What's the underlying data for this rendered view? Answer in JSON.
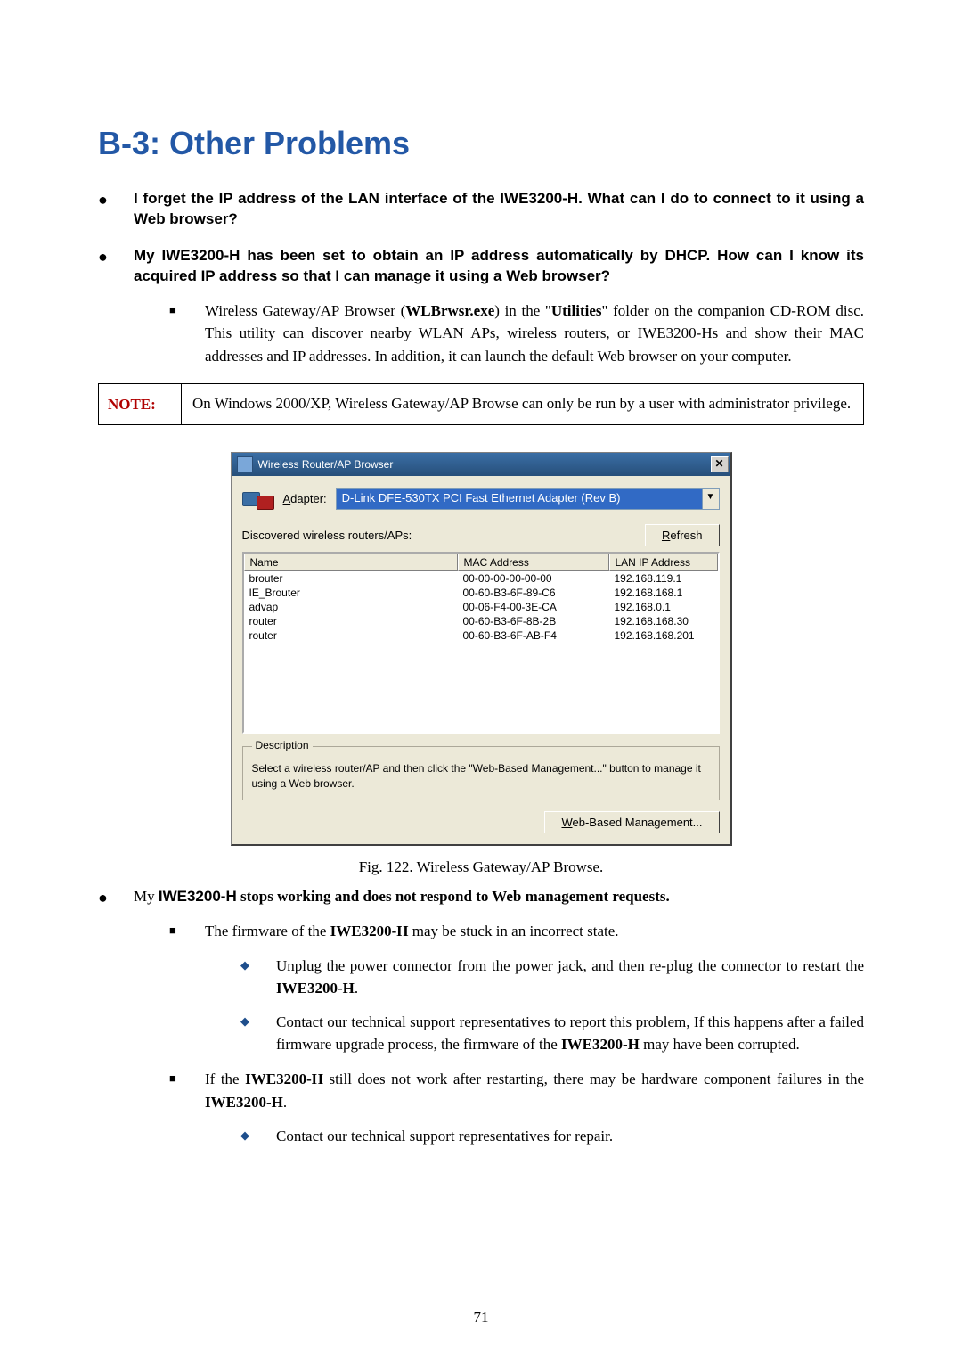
{
  "heading": "B-3: Other Problems",
  "bullets": {
    "b1": {
      "q": "I forget the IP address of the LAN interface of the IWE3200-H. What can I do to connect to it using a Web browser?"
    },
    "b2": {
      "q": "My IWE3200-H has been set to obtain an IP address automatically by DHCP. How can I know its acquired IP address so that I can manage it using a Web browser?",
      "sq_pre": "Wireless Gateway/AP Browser (",
      "sq_bold1": "WLBrwsr.exe",
      "sq_mid": ") in the \"",
      "sq_bold2": "Utilities",
      "sq_post": "\" folder on the companion CD-ROM disc. This utility can discover nearby WLAN APs, wireless routers, or IWE3200-Hs and show their MAC addresses and IP addresses. In addition, it can launch the default Web browser on your computer."
    },
    "b3": {
      "pre": "My ",
      "bold": "IWE3200-H",
      "post": " stops working and does not respond to Web management requests.",
      "sq1_pre": "The firmware of the ",
      "sq1_bold": "IWE3200-H",
      "sq1_post": " may be stuck in an incorrect state.",
      "d1_pre": "Unplug the power connector from the power jack, and then re-plug the connector to restart the ",
      "d1_bold": "IWE3200-H",
      "d1_post": ".",
      "d2_pre": "Contact our technical support representatives to report this problem, If this happens after a failed firmware upgrade process, the firmware of the ",
      "d2_bold": "IWE3200-H",
      "d2_post": " may have been corrupted.",
      "sq2_pre": "If the ",
      "sq2_bold": "IWE3200-H",
      "sq2_mid": " still does not work after restarting, there may be hardware component failures in the ",
      "sq2_bold2": "IWE3200-H",
      "sq2_post": ".",
      "d3": "Contact our technical support representatives for repair."
    }
  },
  "note": {
    "label": "NOTE:",
    "text": "On Windows 2000/XP, Wireless Gateway/AP Browse can only be run by a user with administrator privilege."
  },
  "window": {
    "title": "Wireless Router/AP Browser",
    "adapter_label_a": "A",
    "adapter_label_rest": "dapter:",
    "adapter_value": "D-Link DFE-530TX PCI Fast Ethernet Adapter (Rev B)",
    "discovered": "Discovered wireless routers/APs:",
    "refresh_u": "R",
    "refresh_rest": "efresh",
    "cols": {
      "c0": "Name",
      "c1": "MAC Address",
      "c2": "LAN IP Address"
    },
    "rows": [
      {
        "c0": "brouter",
        "c1": "00-00-00-00-00-00",
        "c2": "192.168.119.1"
      },
      {
        "c0": "IE_Brouter",
        "c1": "00-60-B3-6F-89-C6",
        "c2": "192.168.168.1"
      },
      {
        "c0": "advap",
        "c1": "00-06-F4-00-3E-CA",
        "c2": "192.168.0.1"
      },
      {
        "c0": "router",
        "c1": "00-60-B3-6F-8B-2B",
        "c2": "192.168.168.30"
      },
      {
        "c0": "router",
        "c1": "00-60-B3-6F-AB-F4",
        "c2": "192.168.168.201"
      }
    ],
    "group_title": "Description",
    "group_text": "Select a wireless router/AP and then click the \"Web-Based Management...\" button to manage it using a Web browser.",
    "mgmt_u": "W",
    "mgmt_rest": "eb-Based Management..."
  },
  "fig_caption": "Fig. 122. Wireless Gateway/AP Browse.",
  "page_number": "71"
}
